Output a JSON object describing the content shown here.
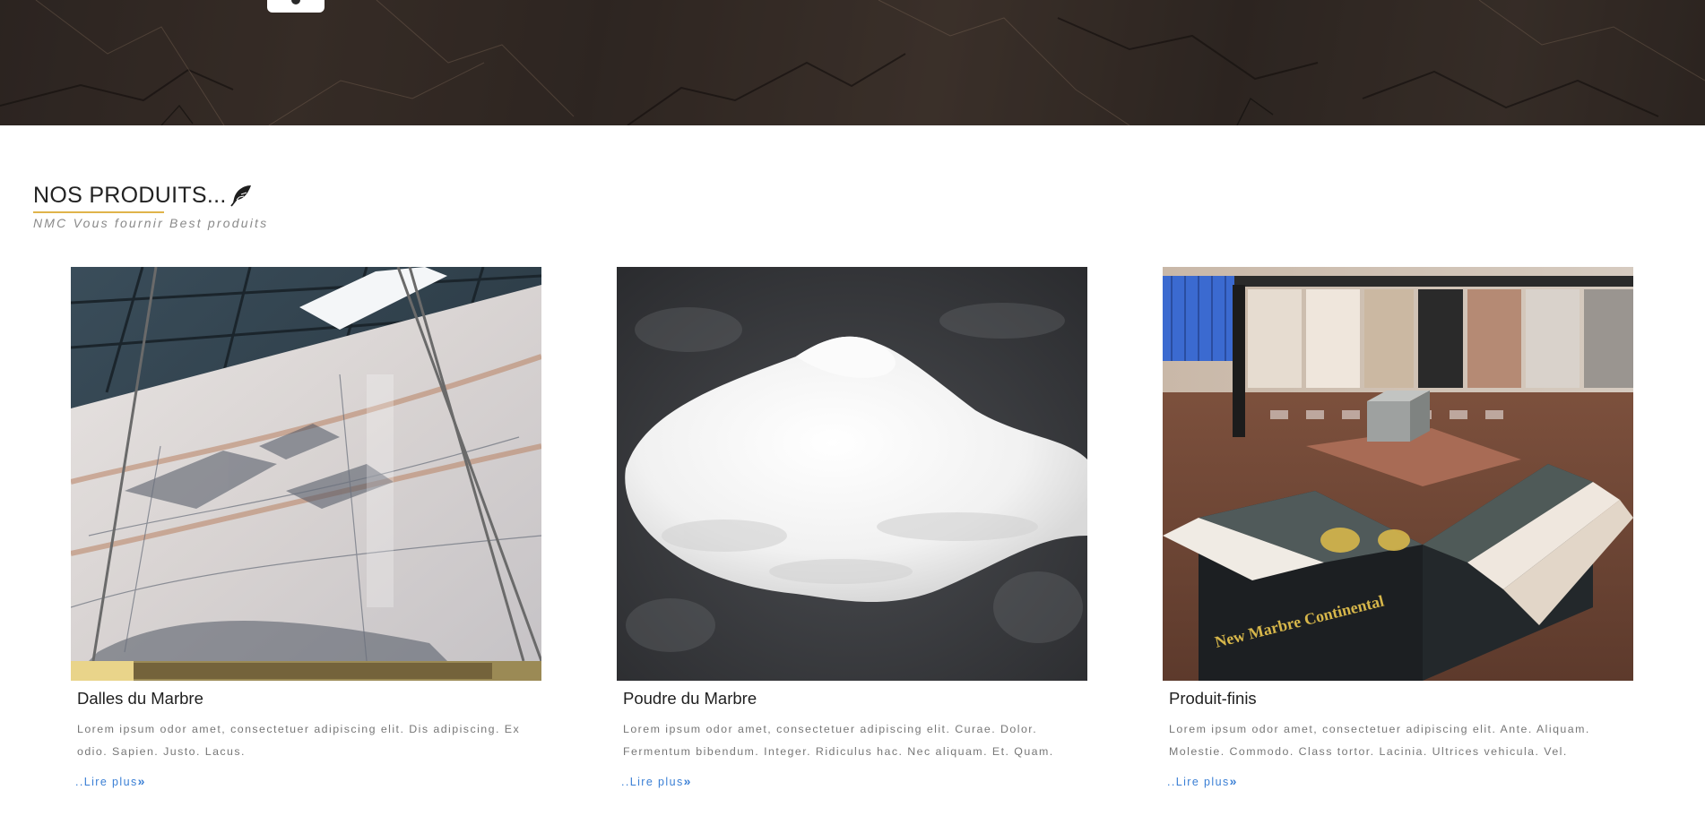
{
  "products_section": {
    "title": "NOS PRODUITS...",
    "subtitle": "NMC Vous fournir Best produits"
  },
  "products": [
    {
      "title": "Dalles du Marbre",
      "description": "Lorem ipsum odor amet, consectetuer adipiscing elit. Dis adipiscing. Ex odio. Sapien. Justo. Lacus.",
      "link_label": "..Lire plus",
      "link_icon": "double-chevron-right-icon"
    },
    {
      "title": "Poudre du Marbre",
      "description": "Lorem ipsum odor amet, consectetuer adipiscing elit. Curae. Dolor. Fermentum bibendum. Integer. Ridiculus hac. Nec aliquam. Et. Quam.",
      "link_label": "..Lire plus",
      "link_icon": "double-chevron-right-icon"
    },
    {
      "title": "Produit-finis",
      "description": "Lorem ipsum odor amet, consectetuer adipiscing elit. Ante. Aliquam. Molestie. Commodo. Class tortor. Lacinia. Ultrices vehicula. Vel.",
      "link_label": "..Lire plus",
      "link_icon": "double-chevron-right-icon",
      "image_sign_text": "New Marbre Continental"
    }
  ],
  "colors": {
    "accent_underline": "#e0b44a",
    "link": "#3a7fd5"
  }
}
